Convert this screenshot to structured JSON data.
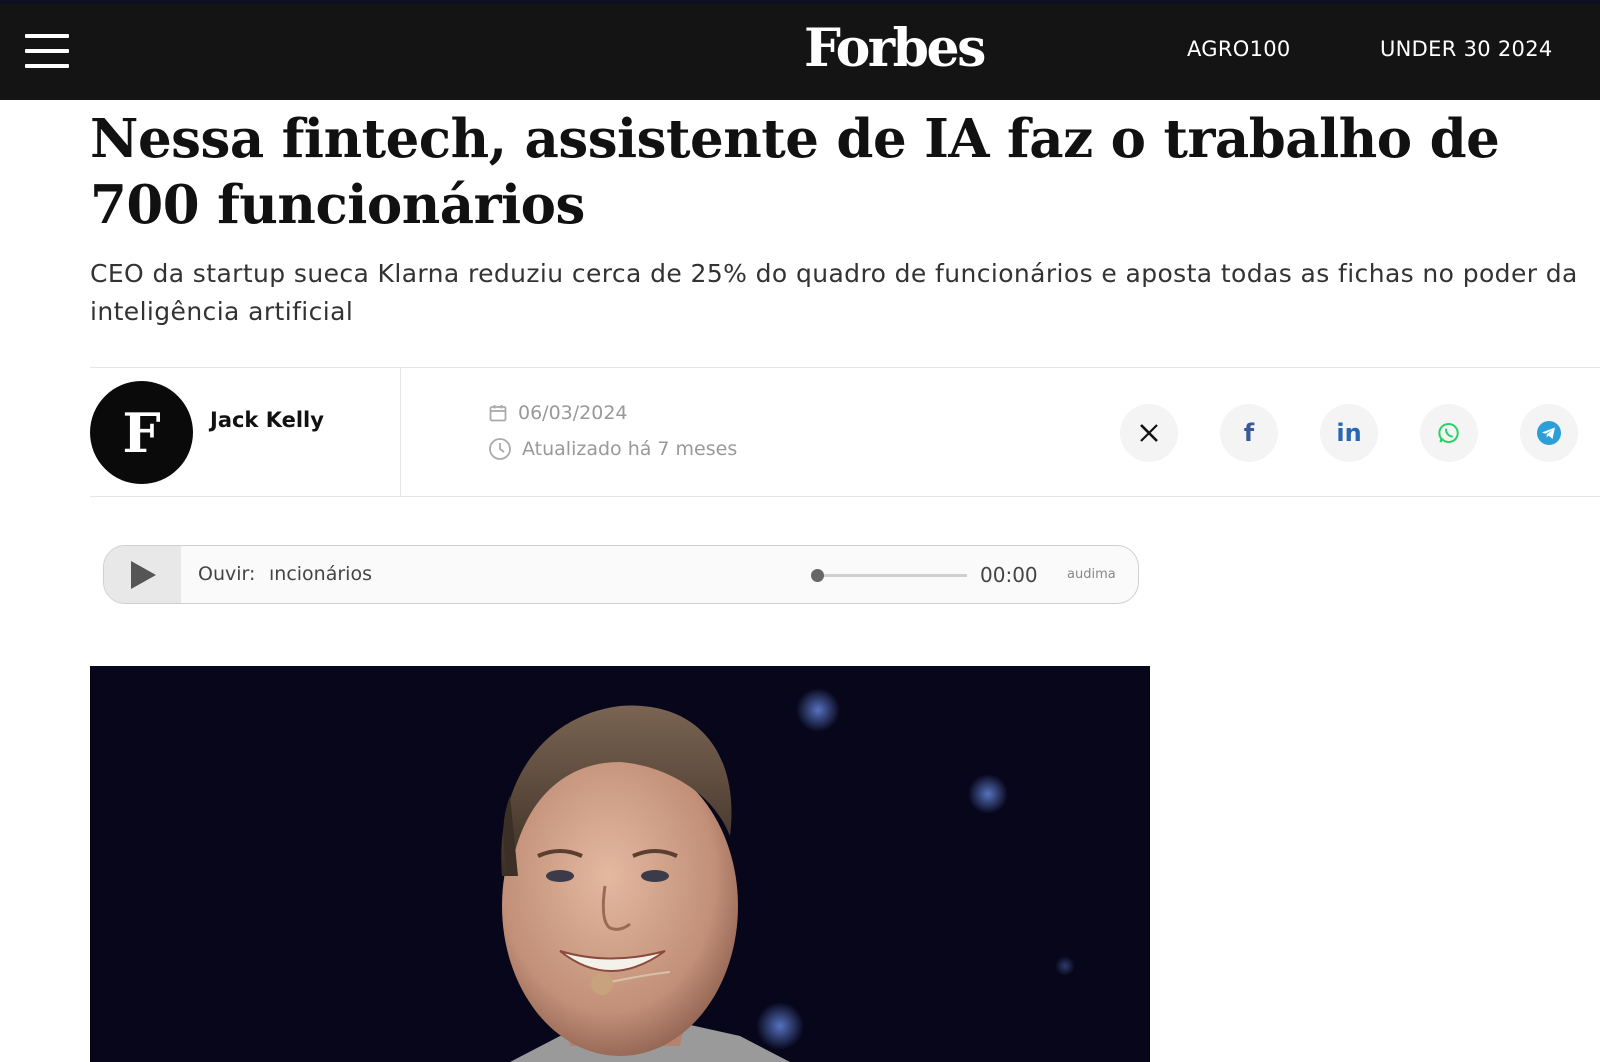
{
  "nav": {
    "logo": "Forbes",
    "links": [
      "AGRO100",
      "UNDER 30 2024"
    ]
  },
  "article": {
    "headline": "Nessa fintech, assistente de IA faz o trabalho de 700 funcionários",
    "subtitle": "CEO da startup sueca Klarna reduziu cerca de 25% do quadro de funcionários e aposta todas as fichas no poder da inteligência artificial",
    "author_initial": "F",
    "author": "Jack Kelly",
    "date": "06/03/2024",
    "updated": "Atualizado há 7 meses"
  },
  "share": {
    "icons": [
      "x-icon",
      "facebook-icon",
      "linkedin-icon",
      "whatsapp-icon",
      "telegram-icon"
    ]
  },
  "player": {
    "label": "Ouvir:",
    "title": "ıncionários",
    "time": "00:00",
    "brand": "audima",
    "progress": 0
  },
  "colors": {
    "navbar": "#141414",
    "top_line": "#0d0f24",
    "meta_text": "#999999",
    "facebook": "#3b5998",
    "linkedin": "#2867b2",
    "whatsapp": "#25d366",
    "telegram": "#2a9fd8"
  }
}
